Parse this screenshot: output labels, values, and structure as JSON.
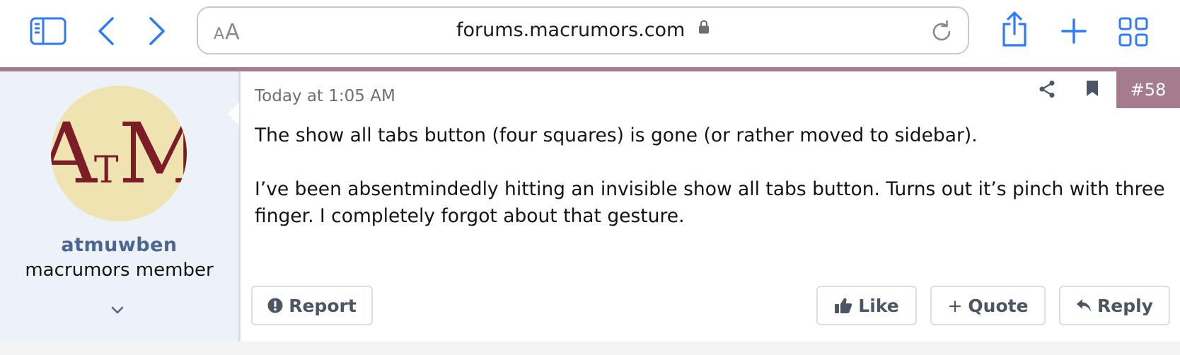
{
  "browser": {
    "sidebar_icon": "sidebar-icon",
    "back_icon": "chevron-left-icon",
    "forward_icon": "chevron-right-icon",
    "address": {
      "text_size_small": "A",
      "text_size_big": "A",
      "url": "forums.macrumors.com",
      "lock_icon": "lock-icon",
      "reload_icon": "reload-icon"
    },
    "share_icon": "share-icon",
    "new_tab_icon": "plus-icon",
    "tabs_overview_icon": "tabs-grid-icon",
    "accent_color": "#2f7bf5"
  },
  "post": {
    "accent_color": "#a47c8e",
    "user": {
      "avatar_letters": {
        "first": "A",
        "middle": "T",
        "last": "M"
      },
      "username": "atmuwben",
      "title": "macrumors member",
      "expand_icon": "chevron-down-icon"
    },
    "date": "Today at 1:05 AM",
    "number": "#58",
    "share_icon": "share-icon",
    "bookmark_icon": "bookmark-icon",
    "body": [
      "The show all tabs button (four squares) is gone (or rather moved to sidebar).",
      "I’ve been absentmindedly hitting an invisible show all tabs button. Turns out it’s pinch with three finger. I completely forgot about that gesture."
    ],
    "actions": {
      "report": "Report",
      "like": "Like",
      "quote": "Quote",
      "quote_prefix": "+",
      "reply": "Reply"
    }
  }
}
